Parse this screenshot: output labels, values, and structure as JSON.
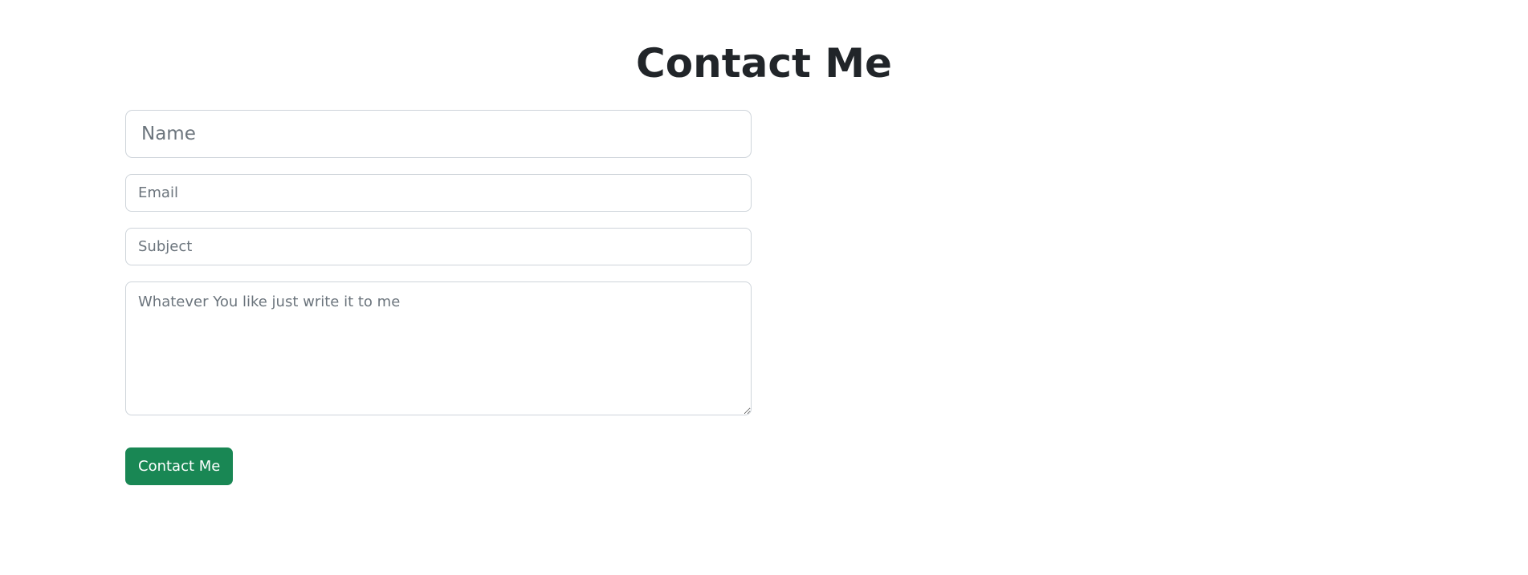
{
  "page": {
    "title": "Contact Me"
  },
  "form": {
    "name": {
      "value": "",
      "placeholder": "Name"
    },
    "email": {
      "value": "",
      "placeholder": "Email"
    },
    "subject": {
      "value": "",
      "placeholder": "Subject"
    },
    "message": {
      "value": "",
      "placeholder": "Whatever You like just write it to me"
    },
    "submit_label": "Contact Me"
  },
  "colors": {
    "button_bg": "#198754",
    "button_text": "#ffffff",
    "border": "#ced4da",
    "placeholder": "#6c757d",
    "heading": "#212529"
  }
}
